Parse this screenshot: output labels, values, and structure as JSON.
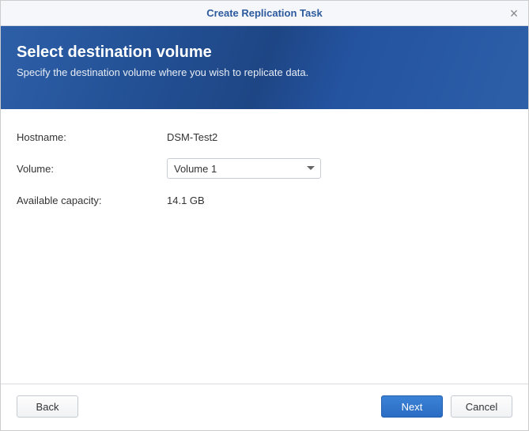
{
  "titlebar": {
    "title": "Create Replication Task"
  },
  "banner": {
    "title": "Select destination volume",
    "subtitle": "Specify the destination volume where you wish to replicate data."
  },
  "form": {
    "hostname_label": "Hostname:",
    "hostname_value": "DSM-Test2",
    "volume_label": "Volume:",
    "volume_selected": "Volume 1",
    "capacity_label": "Available capacity:",
    "capacity_value": "14.1 GB"
  },
  "buttons": {
    "back": "Back",
    "next": "Next",
    "cancel": "Cancel"
  }
}
